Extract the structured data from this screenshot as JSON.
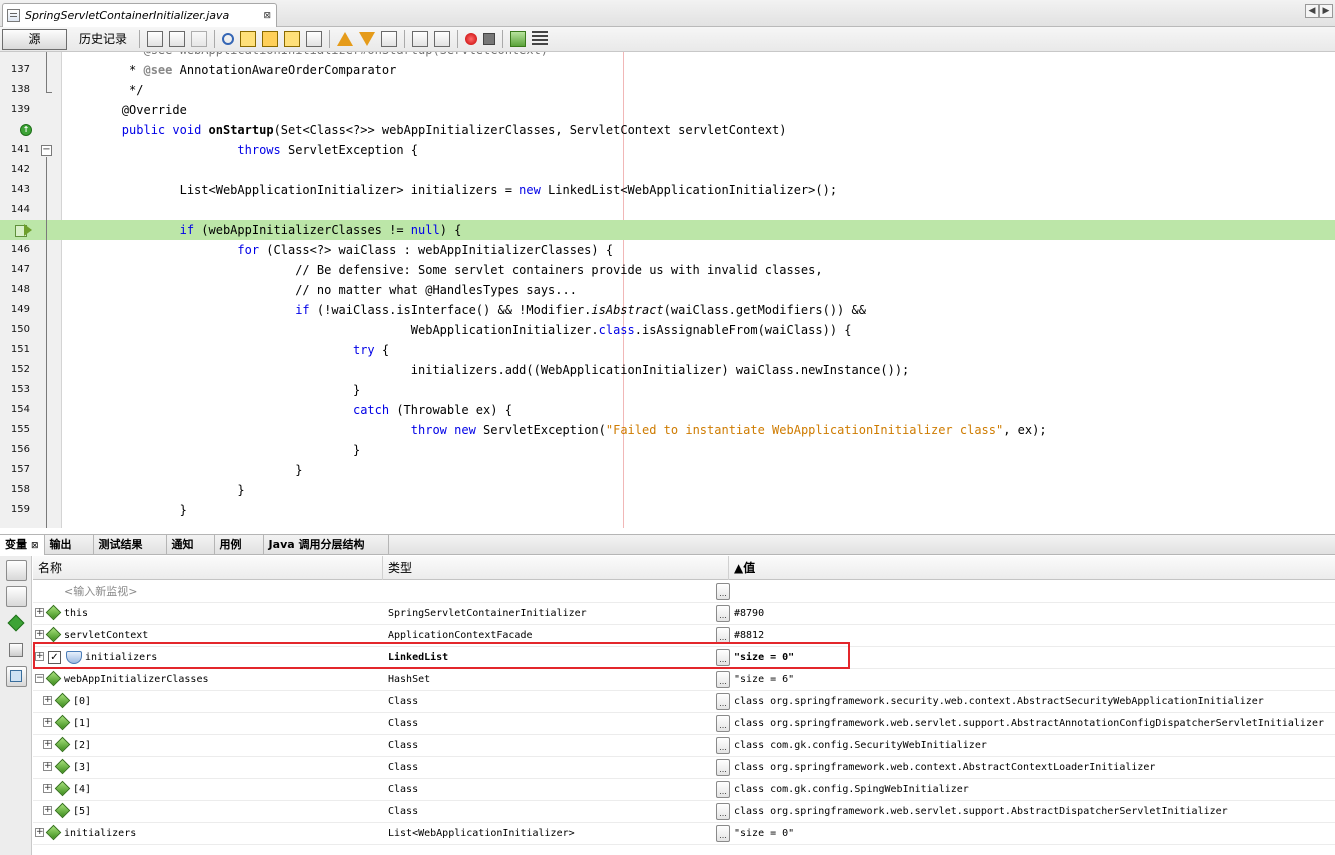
{
  "window": {
    "file_tab": "SpringServletContainerInitializer.java",
    "file_tab_close": "⊠",
    "nav_left": "◀",
    "nav_right": "▶"
  },
  "toolbar": {
    "source_label": "源",
    "history_label": "历史记录",
    "icons": [
      "last-edit-icon",
      "back-icon",
      "forward-icon",
      "find-icon",
      "find-previous-icon",
      "find-next-icon",
      "find-selection-icon",
      "toggle-highlight-icon",
      "prev-bookmark-icon",
      "next-bookmark-icon",
      "toggle-bookmark-icon",
      "shift-left-icon",
      "shift-right-icon",
      "record-macro-icon",
      "stop-macro-icon",
      "comment-icon",
      "uncomment-icon"
    ]
  },
  "editor": {
    "lines": [
      {
        "num": "137",
        "text": "         * @see AnnotationAwareOrderComparator"
      },
      {
        "num": "138",
        "text": "         */"
      },
      {
        "num": "139",
        "text": "        @Override"
      },
      {
        "num": "",
        "text": "        public void onStartup(Set<Class<?>> webAppInitializerClasses, ServletContext servletContext)"
      },
      {
        "num": "141",
        "text": "                        throws ServletException {"
      },
      {
        "num": "142",
        "text": ""
      },
      {
        "num": "143",
        "text": "                List<WebApplicationInitializer> initializers = new LinkedList<WebApplicationInitializer>();"
      },
      {
        "num": "144",
        "text": ""
      },
      {
        "num": "",
        "text": "                if (webAppInitializerClasses != null) {"
      },
      {
        "num": "146",
        "text": "                        for (Class<?> waiClass : webAppInitializerClasses) {"
      },
      {
        "num": "147",
        "text": "                                // Be defensive: Some servlet containers provide us with invalid classes,"
      },
      {
        "num": "148",
        "text": "                                // no matter what @HandlesTypes says..."
      },
      {
        "num": "149",
        "text": "                                if (!waiClass.isInterface() && !Modifier.isAbstract(waiClass.getModifiers()) &&"
      },
      {
        "num": "150",
        "text": "                                                WebApplicationInitializer.class.isAssignableFrom(waiClass)) {"
      },
      {
        "num": "151",
        "text": "                                        try {"
      },
      {
        "num": "152",
        "text": "                                                initializers.add((WebApplicationInitializer) waiClass.newInstance());"
      },
      {
        "num": "153",
        "text": "                                        }"
      },
      {
        "num": "154",
        "text": "                                        catch (Throwable ex) {"
      },
      {
        "num": "155",
        "text": "                                                throw new ServletException(\"Failed to instantiate WebApplicationInitializer class\", ex);"
      },
      {
        "num": "156",
        "text": "                                        }"
      },
      {
        "num": "157",
        "text": "                                }"
      },
      {
        "num": "158",
        "text": "                        }"
      },
      {
        "num": "159",
        "text": "                }"
      }
    ],
    "hidden_top_text": "         * @see WebApplicationInitializer#onStartup(ServletContext)"
  },
  "bottom_tabs": [
    {
      "label": "变量",
      "close": "⊠",
      "active": true
    },
    {
      "label": "输出"
    },
    {
      "label": "测试结果"
    },
    {
      "label": "通知"
    },
    {
      "label": "用例"
    },
    {
      "label": "Java 调用分层结构"
    }
  ],
  "variables": {
    "columns": {
      "name": "名称",
      "type": "类型",
      "value": "▲值"
    },
    "new_watch": "<输入新监视>",
    "rows": [
      {
        "name": "this",
        "type": "SpringServletContainerInitializer",
        "value": "#8790",
        "indent": 0,
        "icon": "field-icon"
      },
      {
        "name": "servletContext",
        "type": "ApplicationContextFacade",
        "value": "#8812",
        "indent": 0,
        "icon": "field-icon"
      },
      {
        "name": "initializers",
        "type": "LinkedList",
        "value": "\"size = 0\"",
        "indent": 0,
        "icon": "watch-icon",
        "highlighted": true
      },
      {
        "name": "webAppInitializerClasses",
        "type": "HashSet",
        "value": "\"size = 6\"",
        "indent": 0,
        "icon": "field-icon",
        "expanded": true
      },
      {
        "name": "[0]",
        "type": "Class",
        "value": "class org.springframework.security.web.context.AbstractSecurityWebApplicationInitializer",
        "indent": 1,
        "icon": "field-icon"
      },
      {
        "name": "[1]",
        "type": "Class",
        "value": "class org.springframework.web.servlet.support.AbstractAnnotationConfigDispatcherServletInitializer",
        "indent": 1,
        "icon": "field-icon"
      },
      {
        "name": "[2]",
        "type": "Class",
        "value": "class com.gk.config.SecurityWebInitializer",
        "indent": 1,
        "icon": "field-icon"
      },
      {
        "name": "[3]",
        "type": "Class",
        "value": "class org.springframework.web.context.AbstractContextLoaderInitializer",
        "indent": 1,
        "icon": "field-icon"
      },
      {
        "name": "[4]",
        "type": "Class",
        "value": "class com.gk.config.SpingWebInitializer",
        "indent": 1,
        "icon": "field-icon"
      },
      {
        "name": "[5]",
        "type": "Class",
        "value": "class org.springframework.web.servlet.support.AbstractDispatcherServletInitializer",
        "indent": 1,
        "icon": "field-icon"
      },
      {
        "name": "initializers",
        "type": "List<WebApplicationInitializer>",
        "value": "\"size = 0\"",
        "indent": 0,
        "icon": "field-icon"
      }
    ]
  },
  "colors": {
    "current_line": "#bce6a8",
    "keyword": "#0000e6",
    "comment": "#969696",
    "string": "#ce7b00",
    "highlight_box": "#e3262b"
  }
}
